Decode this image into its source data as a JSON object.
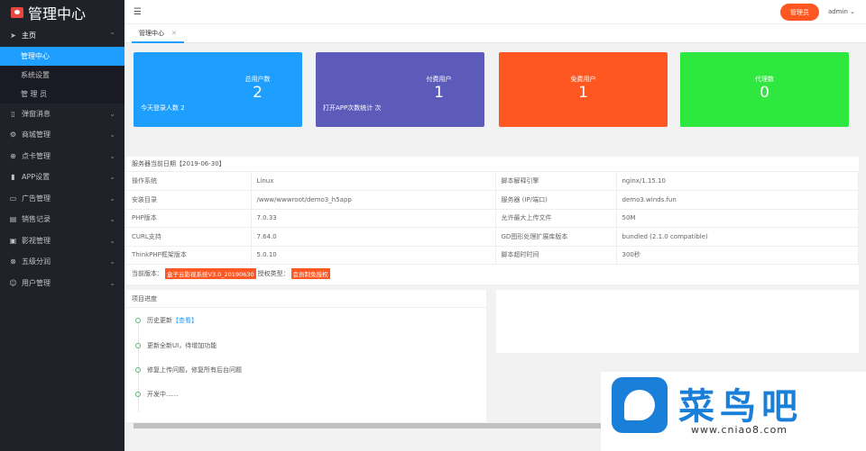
{
  "app": {
    "title": "管理中心"
  },
  "sidebar": {
    "home": {
      "label": "主页",
      "icon": "paper-plane-icon"
    },
    "home_sub": [
      "管理中心",
      "系统设置",
      "管 理 员"
    ],
    "groups": [
      {
        "label": "弹窗消息",
        "icon": "tablet-icon"
      },
      {
        "label": "商城管理",
        "icon": "gear-icon"
      },
      {
        "label": "点卡管理",
        "icon": "cart-icon"
      },
      {
        "label": "APP设置",
        "icon": "phone-icon"
      },
      {
        "label": "广告管理",
        "icon": "doc-icon"
      },
      {
        "label": "销售记录",
        "icon": "list-icon"
      },
      {
        "label": "影视管理",
        "icon": "film-icon"
      },
      {
        "label": "五级分润",
        "icon": "share-icon"
      },
      {
        "label": "用户管理",
        "icon": "user-icon"
      }
    ]
  },
  "header": {
    "admin_badge": "管理员",
    "user": "admin"
  },
  "tabs": [
    {
      "label": "管理中心"
    }
  ],
  "stats": {
    "total_users": {
      "title": "总用户数",
      "value": "2",
      "extra": "今天登录人数 2",
      "color": "#1e9fff"
    },
    "paid_users": {
      "title": "付费用户",
      "value": "1",
      "extra": "打开APP次数统计 次",
      "color": "#5c5bba"
    },
    "free_users": {
      "title": "免费用户",
      "value": "1",
      "color": "#ff5722"
    },
    "agents": {
      "title": "代理数",
      "value": "0",
      "color": "#2fe83f"
    }
  },
  "server": {
    "title": "服务器当前日期【2019-06-30】",
    "rows": [
      [
        "操作系统",
        "Linux",
        "脚本解释引擎",
        "nginx/1.15.10"
      ],
      [
        "安装目录",
        "/www/wwwroot/demo3_h5app",
        "服务器 (IP/端口)",
        "demo3.winds.fun"
      ],
      [
        "PHP版本",
        "7.0.33",
        "允许最大上传文件",
        "50M"
      ],
      [
        "CURL支持",
        "7.64.0",
        "GD图形处理扩展库版本",
        "bundled (2.1.0 compatible)"
      ],
      [
        "ThinkPHP框架版本",
        "5.0.10",
        "脚本超时时间",
        "300秒"
      ]
    ],
    "version_label": "当前版本：",
    "version_value": "盒子云影视系统V3.0_20190630",
    "license_label": "授权类型：",
    "license_value": "会员制免授权"
  },
  "progress": {
    "title": "项目进度",
    "items": [
      {
        "text": "历史更新",
        "link": "【查看】"
      },
      {
        "text": "更新全新UI，待增加功能"
      },
      {
        "text": "修复上传问题，修复所有后台问题"
      },
      {
        "text": "开发中......"
      }
    ]
  },
  "watermark": {
    "text": "菜鸟吧",
    "url": "www.cniao8.com"
  }
}
